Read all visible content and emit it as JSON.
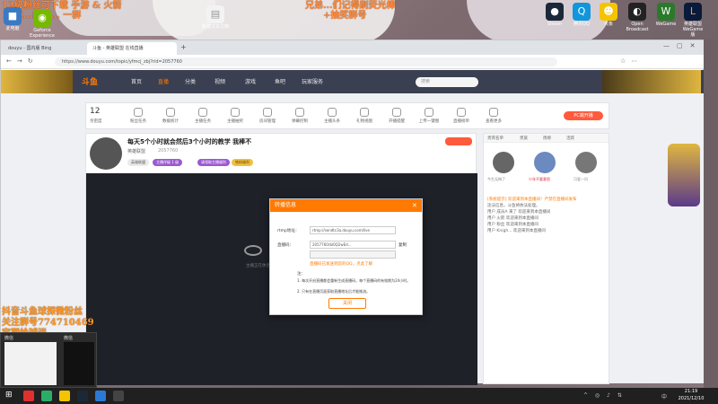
{
  "desktop": {
    "overlay_lines": [
      "12级粉丝可下载 手游 & 火箭",
      "16级...的进... 一群"
    ],
    "overlay_bottom": [
      "抖音斗鱼球探微粉丝",
      "关注群号774710469",
      "定期给球迷"
    ],
    "overlay_center": [
      "兄弟...们记得刷荧光棒",
      "+抽奖群号"
    ],
    "icons_left": [
      {
        "label": "此电脑",
        "icon": "computer-icon"
      },
      {
        "label": "Geforce Experience",
        "icon": "nvidia-icon"
      }
    ],
    "icons_mid": [
      {
        "label": "新建文本文档",
        "icon": "document-icon"
      }
    ],
    "icons_right": [
      {
        "label": "Steam",
        "icon": "steam-icon",
        "color": "#1b2838"
      },
      {
        "label": "腾讯QQ",
        "icon": "qq-icon",
        "color": "#1296db"
      },
      {
        "label": "大象",
        "icon": "cat-icon",
        "color": "#f5c400"
      },
      {
        "label": "Open Broadcast",
        "icon": "obs-icon",
        "color": "#222222"
      },
      {
        "label": "WeGame",
        "icon": "wegame-icon",
        "color": "#2b7a2b"
      },
      {
        "label": "英雄联盟 WeGame版",
        "icon": "lol-icon",
        "color": "#0a1a3a"
      }
    ]
  },
  "browser": {
    "tabs": [
      {
        "label": "douyu - 国内版 Bing",
        "active": false
      },
      {
        "label": "斗鱼 - 英雄联盟 在线直播",
        "active": true
      }
    ],
    "url": "https://www.douyu.com/topic/yfmcj_zbj?rid=2057760",
    "site_logo": "斗鱼",
    "nav_items": [
      "首页",
      "直播",
      "分类",
      "视频",
      "游戏",
      "鱼吧",
      "玩家服务"
    ],
    "search_placeholder": "搜索",
    "tools": [
      {
        "count": "12",
        "label": "亲密度"
      },
      {
        "label": "粉丝任务"
      },
      {
        "label": "数据统计"
      },
      {
        "label": "主播任务"
      },
      {
        "label": "主播抽奖"
      },
      {
        "label": "房间管理"
      },
      {
        "label": "弹幕控制"
      },
      {
        "label": "主播头条"
      },
      {
        "label": "礼物视图"
      },
      {
        "label": "开播提醒"
      },
      {
        "label": "上传一键图"
      },
      {
        "label": "直播榜单"
      },
      {
        "label": "查看更多"
      }
    ],
    "pc_live_button": "PC端开播",
    "stream_title": "每天5个小时就会然后3个小时的教学 我棒不",
    "streamer_name": "英雄联盟",
    "room_id": "2057760",
    "level_badges": [
      "英雄联盟",
      "主播评级 1 级",
      "请领取主播福利",
      "铁粉福利"
    ],
    "video_placeholder": "主播正在休息中，稍后再来",
    "side_tabs": [
      "贵宾名单",
      "贵族",
      "周榜",
      "活跃"
    ],
    "side_avatars": [
      {
        "name": "今生无悔了"
      },
      {
        "name": "少年不要意思"
      },
      {
        "name": "可爱一问"
      }
    ],
    "chat_lines": [
      "[系统提示] 欢迎来到本直播间！严禁在直播间发布",
      "违法信息，斗鱼将依法处理。",
      "用户 成员A 来了 欢迎来到本直播间",
      "用户 火箭 欢迎来到本直播间",
      "用户 粉丝 欢迎来到本直播间",
      "用户 Knigh... 欢迎来到本直播间"
    ]
  },
  "modal": {
    "title": "转播信息",
    "rtmp_label": "rtmp地址：",
    "rtmp_value": "rtmp://sendtc3a.douyu.com/live",
    "key_label": "直播码：",
    "key_value": "2057760rbl0Q2wEd...",
    "copy_label": "复制",
    "hint_text": "直播码已发送到您的QQ，点此了解",
    "notes_title": "注：",
    "notes": [
      "1. 每次开启直播都会重新生成直播码，每个直播码的有效期为24小时。",
      "2. 只有在直播页面获取直播地址后才能推流。"
    ],
    "close_button": "关闭"
  },
  "taskbar": {
    "time": "21:19",
    "date": "2021/12/10",
    "lang": "中"
  },
  "preview": {
    "title": "微信",
    "title2": "微信"
  }
}
